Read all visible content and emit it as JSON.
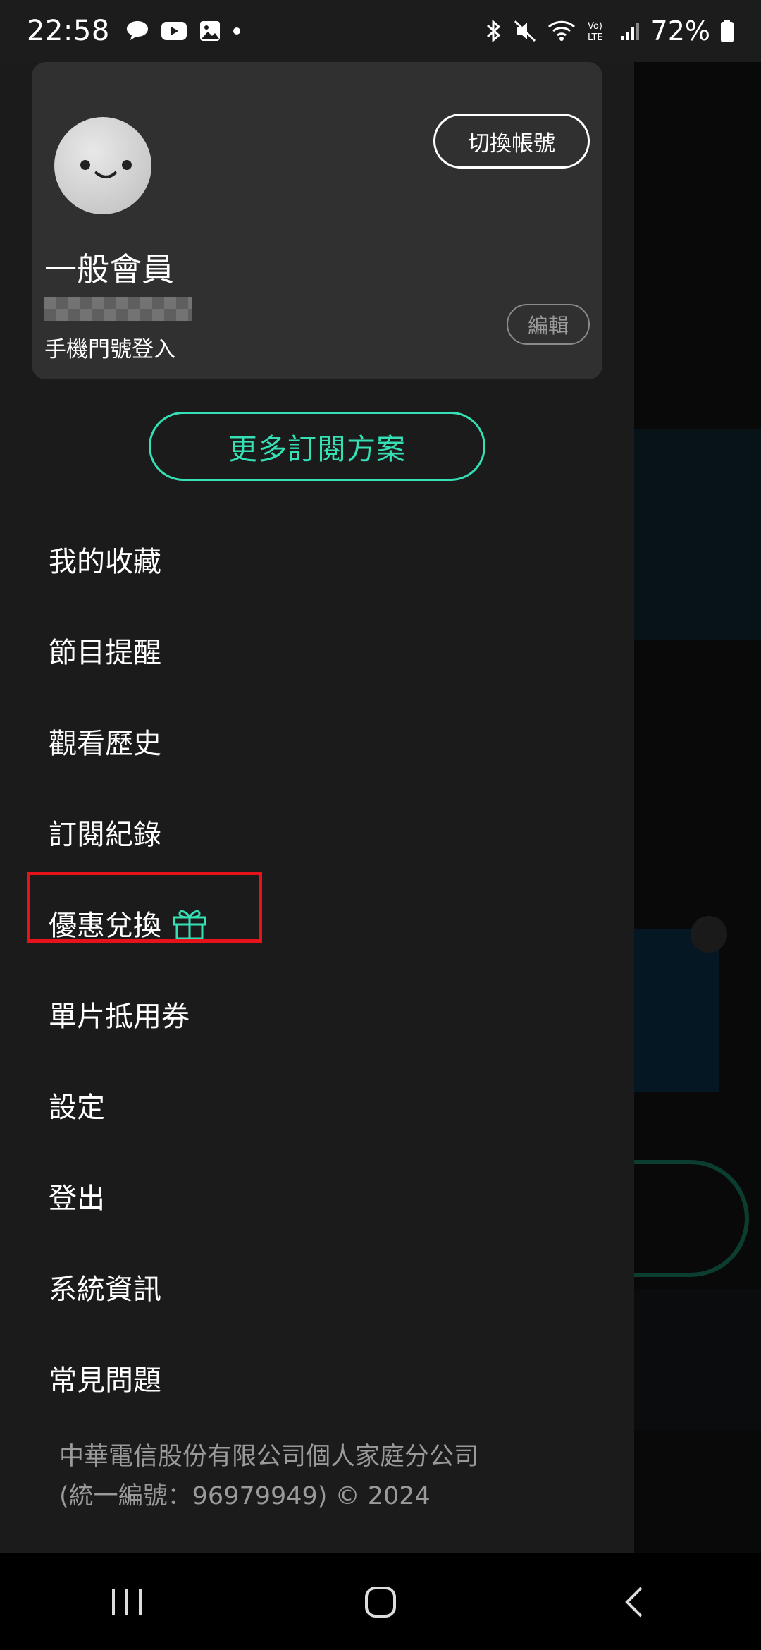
{
  "status_bar": {
    "time": "22:58",
    "battery": "72%",
    "left_icons": [
      "chat-icon",
      "youtube-icon",
      "gallery-icon",
      "dot-icon"
    ],
    "right_icons": [
      "bluetooth-icon",
      "mute-icon",
      "wifi-icon",
      "volte-icon",
      "signal-icon",
      "battery-icon"
    ]
  },
  "profile": {
    "switch_account_label": "切換帳號",
    "member_title": "一般會員",
    "login_method": "手機門號登入",
    "edit_label": "編輯"
  },
  "subscribe_label": "更多訂閱方案",
  "menu": {
    "items": [
      {
        "label": "我的收藏"
      },
      {
        "label": "節目提醒"
      },
      {
        "label": "觀看歷史"
      },
      {
        "label": "訂閱紀錄"
      },
      {
        "label": "優惠兌換",
        "icon": "gift-icon"
      },
      {
        "label": "單片抵用券"
      },
      {
        "label": "設定"
      },
      {
        "label": "登出"
      },
      {
        "label": "系統資訊"
      },
      {
        "label": "常見問題"
      }
    ]
  },
  "footer": {
    "company": "中華電信股份有限公司個人家庭分公司",
    "registration": "(統一編號：96979949) © 2024"
  },
  "colors": {
    "accent": "#35e0b5",
    "highlight": "#e8121b",
    "drawer_bg": "#1b1b1c",
    "card_bg": "#303031"
  },
  "nav_bar": {
    "buttons": [
      "recents-icon",
      "home-icon",
      "back-icon"
    ]
  }
}
